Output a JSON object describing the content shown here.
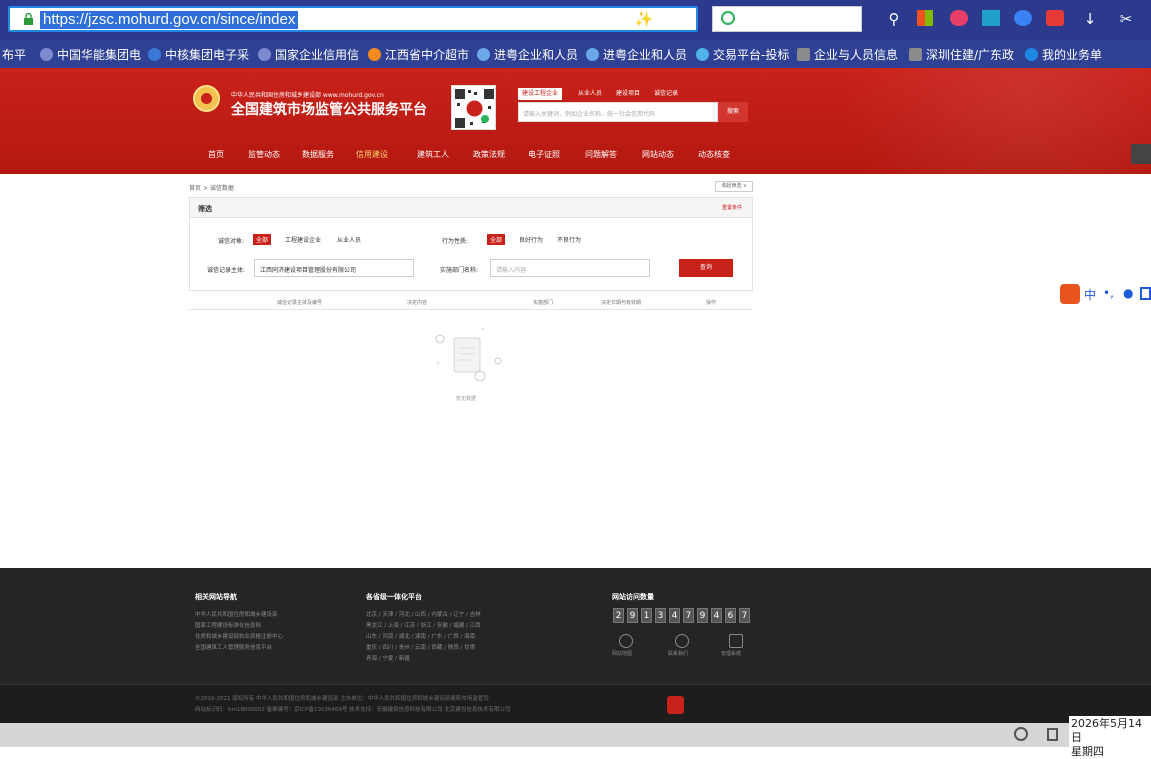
{
  "browser": {
    "url": "https://jzsc.mohurd.gov.cn/since/index",
    "bookmarks": [
      {
        "label": "布平",
        "color": "#2f4194"
      },
      {
        "label": "中国华能集团电",
        "color": "#7d8ad0"
      },
      {
        "label": "中核集团电子采",
        "color": "#3a78d8"
      },
      {
        "label": "国家企业信用信",
        "color": "#7d8ad0"
      },
      {
        "label": "江西省中介超市",
        "color": "#f28a1e"
      },
      {
        "label": "进粤企业和人员",
        "color": "#6aa8e8"
      },
      {
        "label": "进粤企业和人员",
        "color": "#6aa8e8"
      },
      {
        "label": "交易平台-投标",
        "color": "#4fb3e8"
      },
      {
        "label": "企业与人员信息",
        "color": "#8a8a8a"
      },
      {
        "label": "深圳住建/广东政",
        "color": "#8a8a8a"
      },
      {
        "label": "我的业务单",
        "color": "#1e88e5"
      }
    ]
  },
  "header": {
    "ministry": "中华人民共和国住房和城乡建设部  www.mohurd.gov.cn",
    "title": "全国建筑市场监管公共服务平台",
    "search_tabs": [
      "建设工程企业",
      "从业人员",
      "建设项目",
      "诚信记录"
    ],
    "search_placeholder": "请输入关键词，例如企业名称、统一社会信用代码",
    "search_button": "搜索",
    "nav": [
      {
        "label": "首页",
        "active": false
      },
      {
        "label": "监管动态",
        "active": false
      },
      {
        "label": "数据服务",
        "active": false
      },
      {
        "label": "信用建设",
        "active": true
      },
      {
        "label": "建筑工人",
        "active": false
      },
      {
        "label": "政策法规",
        "active": false
      },
      {
        "label": "电子证照",
        "active": false
      },
      {
        "label": "问题解答",
        "active": false
      },
      {
        "label": "网站动态",
        "active": false
      },
      {
        "label": "动态核查",
        "active": false
      }
    ],
    "accent": "#c9221b"
  },
  "page": {
    "breadcrumb": "首页 > 诚信数据",
    "collapse": "收起筛选 ∨",
    "filter_title": "筛选",
    "reset": "重置条件",
    "record_object_label": "诚信对象:",
    "record_object_options": [
      "全部",
      "工程建设企业",
      "从业人员"
    ],
    "behavior_label": "行为性质:",
    "behavior_options": [
      "全部",
      "良好行为",
      "不良行为"
    ],
    "subject_label": "诚信记录主体:",
    "subject_value": "江西同济建设项目管理股份有限公司",
    "dept_label": "实施部门名称:",
    "dept_placeholder": "请输入内容",
    "query_button": "查询",
    "table_headers": [
      "诚信记录主体及编号",
      "决定内容",
      "实施部门",
      "决定日期与有效期",
      "操作"
    ],
    "empty_text": "暂无数据"
  },
  "footer": {
    "links_title": "相关网站导航",
    "links": [
      "中华人民共和国住房和城乡建设部",
      "国家工程建设标准化信息网",
      "住房和城乡建设部执业资格注册中心",
      "全国建筑工人管理服务信息平台"
    ],
    "provinces_title": "各省级一体化平台",
    "provinces": [
      "北京 / 天津 / 河北 / 山西 / 内蒙古 / 辽宁 / 吉林",
      "黑龙江 / 上海 / 江苏 / 浙江 / 安徽 / 福建 / 江西",
      "山东 / 河南 / 湖北 / 湖南 / 广东 / 广西 / 海南",
      "重庆 / 四川 / 贵州 / 云南 / 西藏 / 陕西 / 甘肃",
      "青海 / 宁夏 / 新疆"
    ],
    "visits_title": "网站访问数量",
    "visit_digits": [
      "2",
      "9",
      "1",
      "3",
      "4",
      "7",
      "9",
      "4",
      "6",
      "7"
    ],
    "icons": [
      {
        "name": "site-map",
        "label": "网站地图"
      },
      {
        "name": "contact-us",
        "label": "联系我们"
      },
      {
        "name": "admin-system",
        "label": "管理系统"
      }
    ],
    "copyright": "©2016-2021 版权所有 中华人民共和国住房和城乡建设部  主办单位：中华人民共和国住房和城乡建设部建筑市场监管司",
    "icp": "网站标识码：bm18000002  备案编号：京ICP备10036469号  技术支持：安徽建筑信息科技有限公司 北京建设信息技术有限公司"
  },
  "system": {
    "date": "2026年5月14日",
    "weekday": "星期四"
  }
}
